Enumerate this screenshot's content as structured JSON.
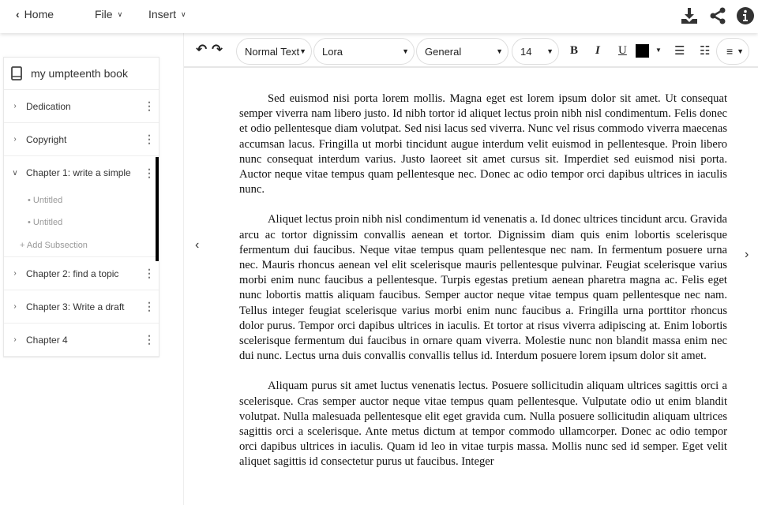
{
  "topbar": {
    "home": "Home",
    "file": "File",
    "insert": "Insert"
  },
  "sidebar": {
    "book_title": "my umpteenth book",
    "items": [
      {
        "label": "Dedication"
      },
      {
        "label": "Copyright"
      },
      {
        "label": "Chapter 1: write a simple",
        "subsections": [
          "Untitled",
          "Untitled"
        ],
        "add_label": "+ Add Subsection"
      },
      {
        "label": "Chapter 2: find a topic"
      },
      {
        "label": "Chapter 3: Write a draft"
      },
      {
        "label": "Chapter 4"
      }
    ]
  },
  "toolbar": {
    "style": "Normal Text",
    "font": "Lora",
    "category": "General",
    "size": "14",
    "bold": "B",
    "italic": "I",
    "underline": "U",
    "text_color": "#000000"
  },
  "document": {
    "paragraphs": [
      "Sed euismod nisi porta lorem mollis. Magna eget est lorem ipsum dolor sit amet. Ut consequat semper viverra nam libero justo. Id nibh tortor id aliquet lectus proin nibh nisl condimentum. Felis donec et odio pellentesque diam volutpat. Sed nisi lacus sed viverra. Nunc vel risus commodo viverra maecenas accumsan lacus. Fringilla ut morbi tincidunt augue interdum velit euismod in pellentesque. Proin libero nunc consequat interdum varius. Justo laoreet sit amet cursus sit. Imperdiet sed euismod nisi porta. Auctor neque vitae tempus quam pellentesque nec. Donec ac odio tempor orci dapibus ultrices in iaculis nunc.",
      "Aliquet lectus proin nibh nisl condimentum id venenatis a. Id donec ultrices tincidunt arcu. Gravida arcu ac tortor dignissim convallis aenean et tortor. Dignissim diam quis enim lobortis scelerisque fermentum dui faucibus. Neque vitae tempus quam pellentesque nec nam. In fermentum posuere urna nec. Mauris rhoncus aenean vel elit scelerisque mauris pellentesque pulvinar. Feugiat scelerisque varius morbi enim nunc faucibus a pellentesque. Turpis egestas pretium aenean pharetra magna ac. Felis eget nunc lobortis mattis aliquam faucibus. Semper auctor neque vitae tempus quam pellentesque nec nam. Tellus integer feugiat scelerisque varius morbi enim nunc faucibus a. Fringilla urna porttitor rhoncus dolor purus. Tempor orci dapibus ultrices in iaculis. Et tortor at risus viverra adipiscing at. Enim lobortis scelerisque fermentum dui faucibus in ornare quam viverra. Molestie nunc non blandit massa enim nec dui nunc. Lectus urna duis convallis convallis tellus id. Interdum posuere lorem ipsum dolor sit amet.",
      "Aliquam purus sit amet luctus venenatis lectus. Posuere sollicitudin aliquam ultrices sagittis orci a scelerisque. Cras semper auctor neque vitae tempus quam pellentesque. Vulputate odio ut enim blandit volutpat. Nulla malesuada pellentesque elit eget gravida cum. Nulla posuere sollicitudin aliquam ultrices sagittis orci a scelerisque. Ante metus dictum at tempor commodo ullamcorper. Donec ac odio tempor orci dapibus ultrices in iaculis. Quam id leo in vitae turpis massa. Mollis nunc sed id semper. Eget velit aliquet sagittis id consectetur purus ut faucibus. Integer"
    ]
  }
}
